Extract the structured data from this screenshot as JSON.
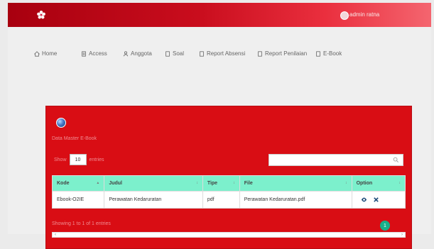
{
  "topbar": {
    "user_name": "admin ratna"
  },
  "nav": {
    "items": [
      {
        "label": "Home",
        "icon": "home-icon"
      },
      {
        "label": "Access",
        "icon": "access-icon"
      },
      {
        "label": "Anggota",
        "icon": "user-icon"
      },
      {
        "label": "Soal",
        "icon": "doc-icon"
      },
      {
        "label": "Report Absensi",
        "icon": "doc-icon"
      },
      {
        "label": "Report Penilaian",
        "icon": "doc-icon"
      },
      {
        "label": "E-Book",
        "icon": "book-icon"
      }
    ]
  },
  "panel": {
    "title": "Data Master E-Book",
    "length_prefix": "Show",
    "length_value": "10",
    "length_suffix": "entries",
    "search_placeholder": ""
  },
  "table": {
    "headers": [
      "Kode",
      "Judul",
      "Tipe",
      "File",
      "Option"
    ],
    "rows": [
      {
        "kode": "Ebook-O2IE",
        "judul": "Perawatan Kedaruratan",
        "tipe": "pdf",
        "file": "Perawatan Kedaruratan.pdf"
      }
    ]
  },
  "pagination": {
    "info": "Showing 1 to 1 of 1 entries",
    "current": "1"
  },
  "colors": {
    "header_gradient_start": "#a8000f",
    "panel": "#d90d14",
    "table_header": "#7cf0cc",
    "page_button": "#17b08b"
  }
}
